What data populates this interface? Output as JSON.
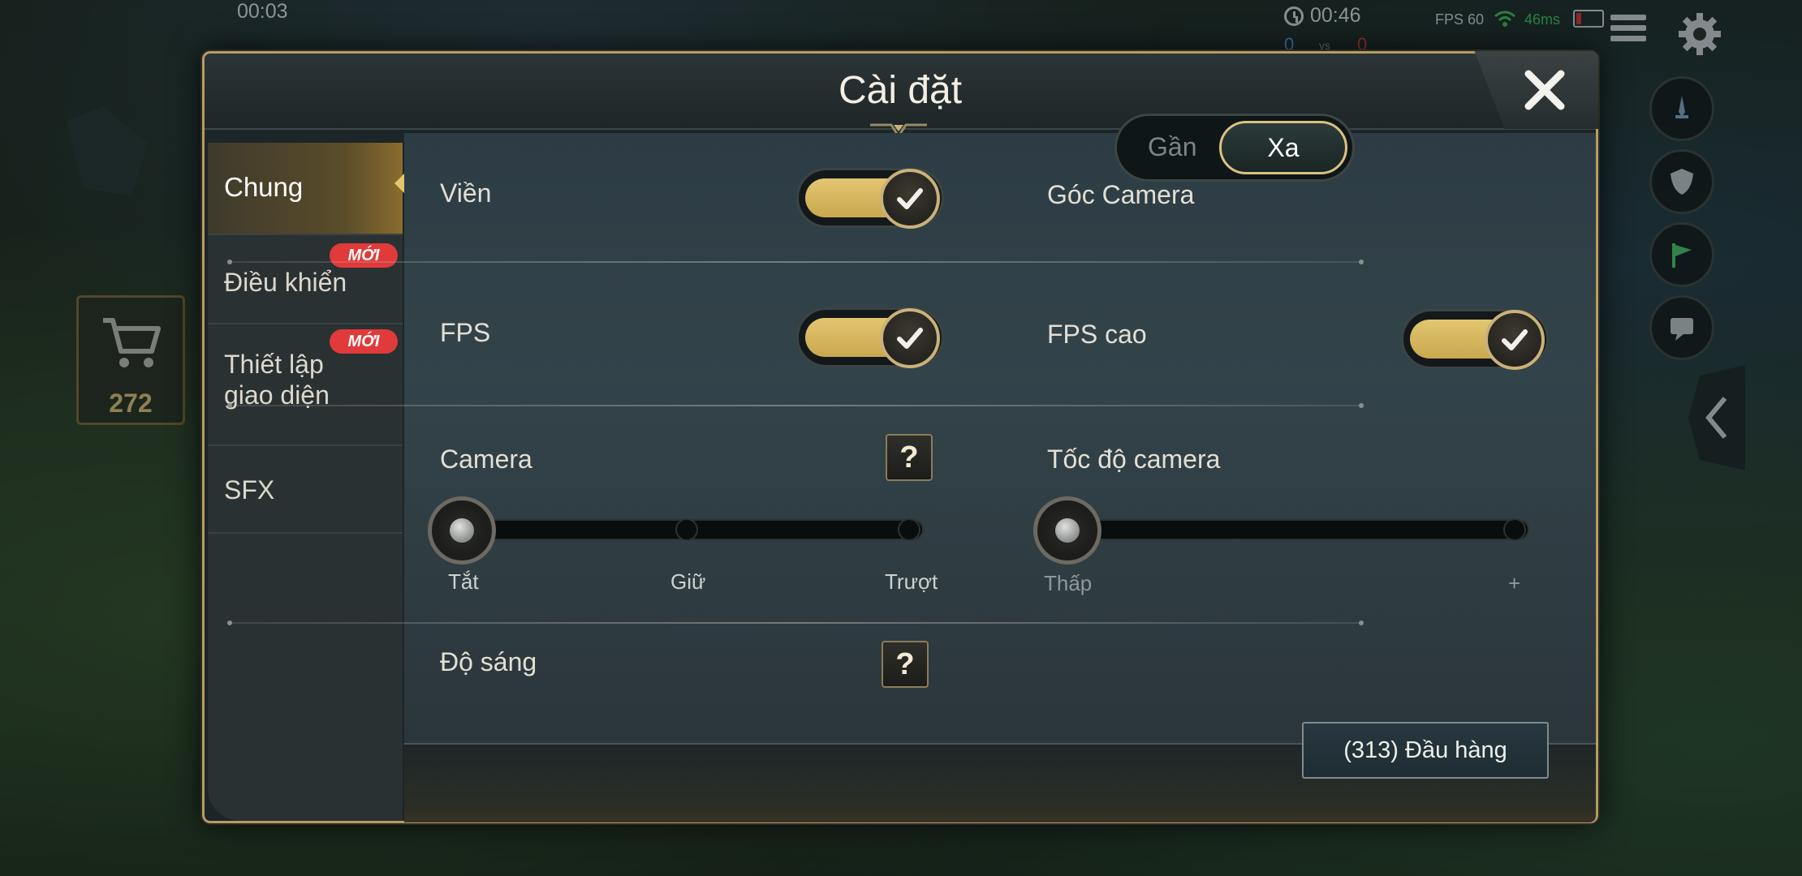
{
  "hud": {
    "match_time": "00:03",
    "game_time": "00:46",
    "fps": "FPS 60",
    "ping": "46ms",
    "score_blue": "0",
    "score_vs": "vs",
    "score_red": "0",
    "gold": "272"
  },
  "dialog": {
    "title": "Cài đặt"
  },
  "sidebar": {
    "items": [
      {
        "label": "Chung",
        "selected": true
      },
      {
        "label": "Điều khiển",
        "badge": "MỚI"
      },
      {
        "label": "Thiết lập giao diện",
        "badge": "MỚI"
      },
      {
        "label": "SFX"
      }
    ]
  },
  "settings": {
    "border": {
      "label": "Viền",
      "enabled": true
    },
    "camera_angle": {
      "label": "Góc Camera",
      "options": [
        "Gần",
        "Xa"
      ],
      "selected": "Xa"
    },
    "fps": {
      "label": "FPS",
      "enabled": true
    },
    "high_fps": {
      "label": "FPS cao",
      "enabled": true
    },
    "camera": {
      "label": "Camera",
      "help": "?",
      "stops": [
        "Tắt",
        "Giữ",
        "Trượt"
      ],
      "value": "Tắt"
    },
    "camera_speed": {
      "label": "Tốc độ camera",
      "min_label": "Thấp",
      "max_label": "+",
      "level": 0
    },
    "brightness": {
      "label": "Độ sáng",
      "help": "?"
    }
  },
  "footer": {
    "surrender_label": "(313)  Đầu hàng"
  },
  "colors": {
    "accent_gold": "#c9a84e",
    "badge_red": "#e03a3a",
    "panel": "#2d3c44"
  },
  "icons": [
    "clock-icon",
    "wifi-icon",
    "battery-icon",
    "menu-icon",
    "gear-icon",
    "cart-icon",
    "close-icon",
    "check-icon",
    "question-icon",
    "sword-icon",
    "shield-icon",
    "flag-icon",
    "chat-icon",
    "chevron-left-icon"
  ]
}
